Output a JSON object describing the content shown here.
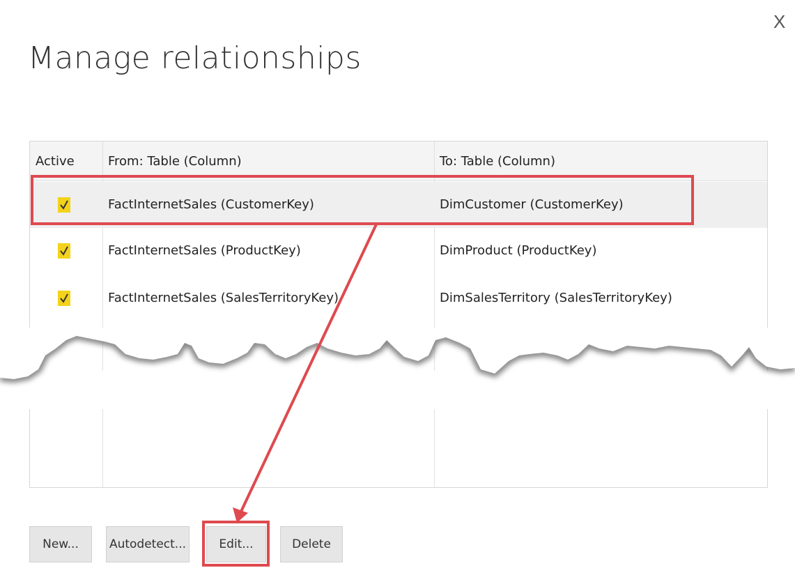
{
  "dialog": {
    "title": "Manage relationships",
    "close_label": "X"
  },
  "table": {
    "headers": [
      "Active",
      "From: Table (Column)",
      "To: Table (Column)"
    ],
    "rows": [
      {
        "active": true,
        "from": "FactInternetSales (CustomerKey)",
        "to": "DimCustomer (CustomerKey)"
      },
      {
        "active": true,
        "from": "FactInternetSales (ProductKey)",
        "to": "DimProduct (ProductKey)"
      },
      {
        "active": true,
        "from": "FactInternetSales (SalesTerritoryKey)",
        "to": "DimSalesTerritory (SalesTerritoryKey)"
      }
    ]
  },
  "buttons": {
    "new_label": "New...",
    "autodetect_label": "Autodetect...",
    "edit_label": "Edit...",
    "delete_label": "Delete"
  },
  "colors": {
    "checkbox": "#f3d21b",
    "annotation": "#de4a4f",
    "header_bg": "#f4f4f4",
    "button_bg": "#e6e6e6"
  }
}
